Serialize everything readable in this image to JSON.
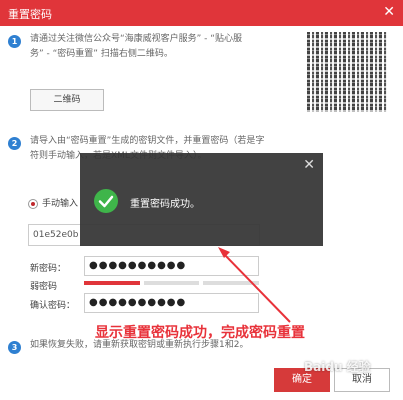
{
  "dialog": {
    "title": "重置密码",
    "close_glyph": "✕"
  },
  "step1": {
    "number": "1",
    "text_line1": "请通过关注微信公众号“海康威视客户服务” - “贴心服",
    "text_line2": "务” - “密码重置” 扫描右侧二维码。",
    "qr_button_label": "二维码"
  },
  "step2": {
    "number": "2",
    "text_line1": "请导入由“密码重置”生成的密钥文件，并重置密码（若是字",
    "text_line2": "符则手动输入，若是XML文件则文件导入）。",
    "radio_label": "手动输入",
    "code_value": "01e52e0b"
  },
  "form": {
    "new_password_label": "新密码：",
    "new_password_value": "●●●●●●●●●●",
    "strength_label": "弱密码",
    "strength_level": 1,
    "strength_max": 3,
    "confirm_label": "确认密码：",
    "confirm_value": "●●●●●●●●●●"
  },
  "step3": {
    "number": "3",
    "text": "如果恢复失败，请重新获取密钥或重新执行步骤1和2。"
  },
  "footer": {
    "ok_label": "确定",
    "cancel_label": "取消"
  },
  "toast": {
    "message": "重置密码成功。",
    "close_glyph": "✕"
  },
  "annotation": {
    "text": "显示重置密码成功，完成密码重置",
    "color": "#e8323a"
  },
  "watermark": {
    "text": "Baidu 经验"
  },
  "colors": {
    "accent": "#e0353a",
    "step_blue": "#2f80d1",
    "success_green": "#3fb54a"
  }
}
